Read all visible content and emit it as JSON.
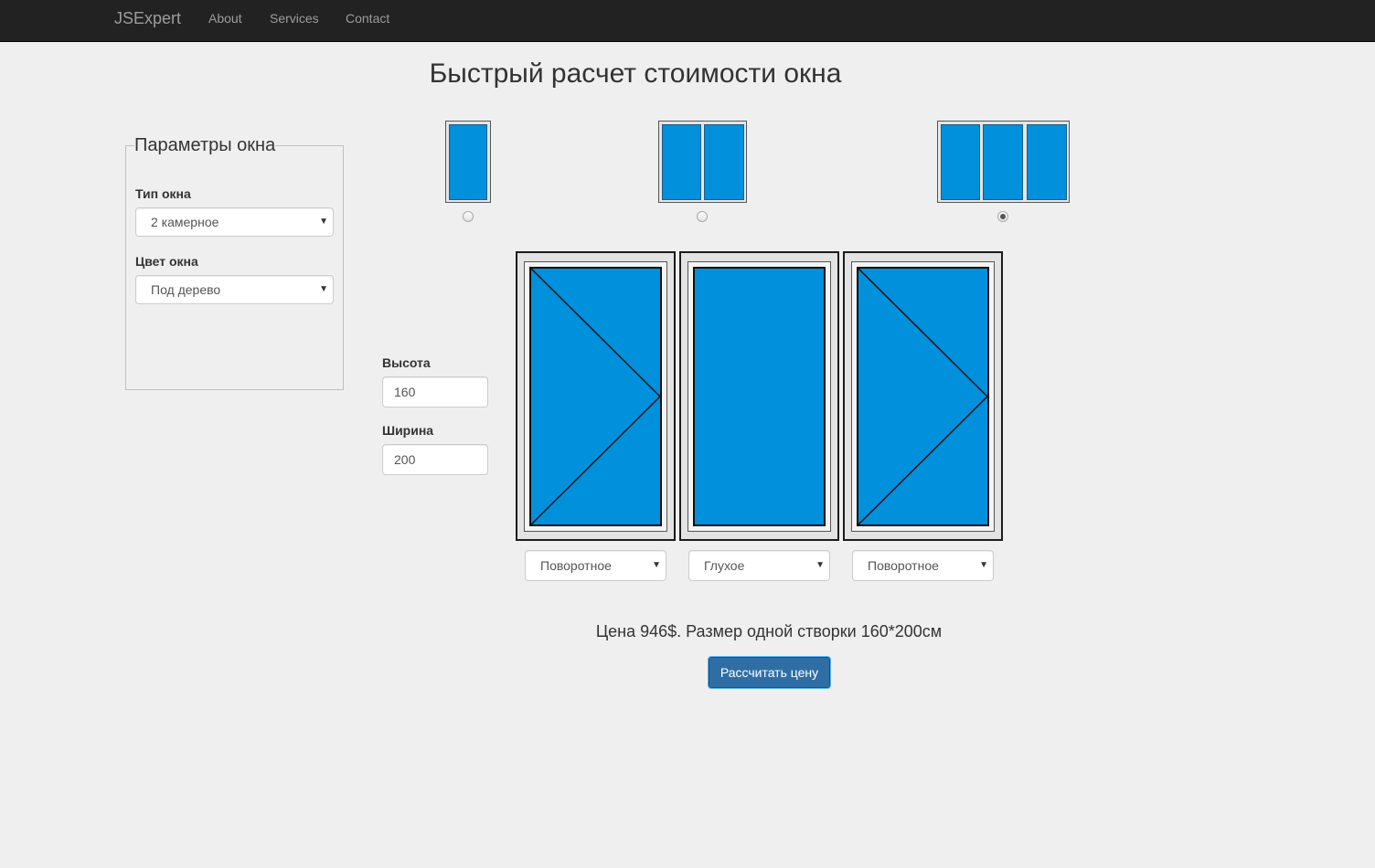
{
  "navbar": {
    "brand": "JSExpert",
    "links": [
      "About",
      "Services",
      "Contact"
    ]
  },
  "page_title": "Быстрый расчет стоимости окна",
  "params": {
    "legend": "Параметры окна",
    "type_label": "Тип окна",
    "type_value": "2 камерное",
    "color_label": "Цвет окна",
    "color_value": "Под дерево"
  },
  "dimensions": {
    "height_label": "Высота",
    "height_value": "160",
    "width_label": "Ширина",
    "width_value": "200"
  },
  "window_layouts": [
    {
      "panes": 1,
      "selected": false
    },
    {
      "panes": 2,
      "selected": false
    },
    {
      "panes": 3,
      "selected": true
    }
  ],
  "sashes": [
    {
      "type": "Поворотное",
      "opening": "turn"
    },
    {
      "type": "Глухое",
      "opening": "fixed"
    },
    {
      "type": "Поворотное",
      "opening": "turn"
    }
  ],
  "price_text": "Цена 946$. Размер одной створки 160*200см",
  "calc_button": "Рассчитать цену",
  "colors": {
    "navbar_bg": "#222222",
    "glass": "#0090dc",
    "button": "#2f6ea5",
    "page_bg": "#efefef"
  }
}
